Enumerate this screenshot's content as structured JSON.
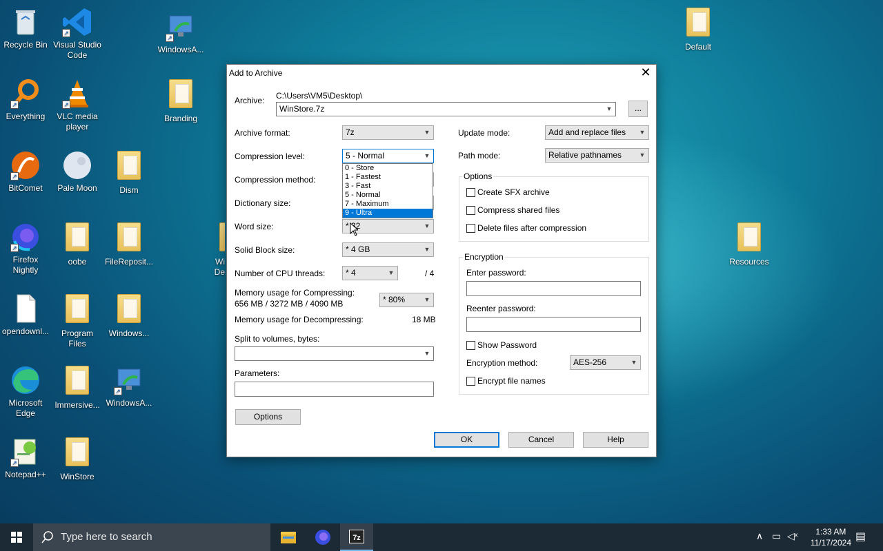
{
  "desktop": {
    "icons": [
      {
        "label": "Recycle Bin",
        "icon": "recycle-bin-icon"
      },
      {
        "label": "Visual Studio Code",
        "icon": "vscode-icon"
      },
      {
        "label": "WindowsA...",
        "icon": "windows-app-icon"
      },
      {
        "label": "Default",
        "icon": "folder-icon"
      },
      {
        "label": "Everything",
        "icon": "everything-icon"
      },
      {
        "label": "VLC media player",
        "icon": "vlc-icon"
      },
      {
        "label": "Branding",
        "icon": "folder-icon"
      },
      {
        "label": "BitComet",
        "icon": "bitcomet-icon"
      },
      {
        "label": "Pale Moon",
        "icon": "pale-moon-icon"
      },
      {
        "label": "Dism",
        "icon": "folder-icon"
      },
      {
        "label": "Firefox Nightly",
        "icon": "firefox-nightly-icon"
      },
      {
        "label": "oobe",
        "icon": "folder-icon"
      },
      {
        "label": "FileReposit...",
        "icon": "folder-icon"
      },
      {
        "label": "Resources",
        "icon": "folder-icon"
      },
      {
        "label": "opendownl...",
        "icon": "file-icon"
      },
      {
        "label": "Program Files",
        "icon": "folder-icon"
      },
      {
        "label": "Windows...",
        "icon": "folder-icon"
      },
      {
        "label": "Microsoft Edge",
        "icon": "edge-icon"
      },
      {
        "label": "Immersive...",
        "icon": "folder-icon"
      },
      {
        "label": "WindowsA...",
        "icon": "windows-app-icon"
      },
      {
        "label": "Notepad++",
        "icon": "notepadpp-icon"
      },
      {
        "label": "WinStore",
        "icon": "folder-icon"
      },
      {
        "label": "Wi",
        "icon": "folder-icon"
      },
      {
        "label": "De",
        "icon": "folder-icon"
      }
    ]
  },
  "dialog": {
    "title": "Add to Archive",
    "archive_label": "Archive:",
    "archive_path": "C:\\Users\\VM5\\Desktop\\",
    "archive_name": "WinStore.7z",
    "browse_label": "...",
    "format_label": "Archive format:",
    "format_value": "7z",
    "level_label": "Compression level:",
    "level_value": "5 - Normal",
    "level_options": [
      "0 - Store",
      "1 - Fastest",
      "3 - Fast",
      "5 - Normal",
      "7 - Maximum",
      "9 - Ultra"
    ],
    "level_highlighted": "9 - Ultra",
    "method_label": "Compression method:",
    "dict_label": "Dictionary size:",
    "word_label": "Word size:",
    "word_value": "* 32",
    "solid_label": "Solid Block size:",
    "solid_value": "* 4 GB",
    "threads_label": "Number of CPU threads:",
    "threads_value": "* 4",
    "threads_max": "/ 4",
    "mem_comp_label": "Memory usage for Compressing:",
    "mem_comp_detail": "656 MB / 3272 MB / 4090 MB",
    "mem_comp_value": "* 80%",
    "mem_decomp_label": "Memory usage for Decompressing:",
    "mem_decomp_value": "18 MB",
    "split_label": "Split to volumes, bytes:",
    "split_value": "",
    "params_label": "Parameters:",
    "params_value": "",
    "options_button": "Options",
    "update_label": "Update mode:",
    "update_value": "Add and replace files",
    "path_label": "Path mode:",
    "path_value": "Relative pathnames",
    "options_group": "Options",
    "opt_sfx": "Create SFX archive",
    "opt_shared": "Compress shared files",
    "opt_delete": "Delete files after compression",
    "enc_group": "Encryption",
    "enter_pw_label": "Enter password:",
    "reenter_pw_label": "Reenter password:",
    "show_pw": "Show Password",
    "enc_method_label": "Encryption method:",
    "enc_method_value": "AES-256",
    "enc_names": "Encrypt file names",
    "ok": "OK",
    "cancel": "Cancel",
    "help": "Help"
  },
  "taskbar": {
    "search_placeholder": "Type here to search",
    "time": "1:33 AM",
    "date": "11/17/2024"
  }
}
